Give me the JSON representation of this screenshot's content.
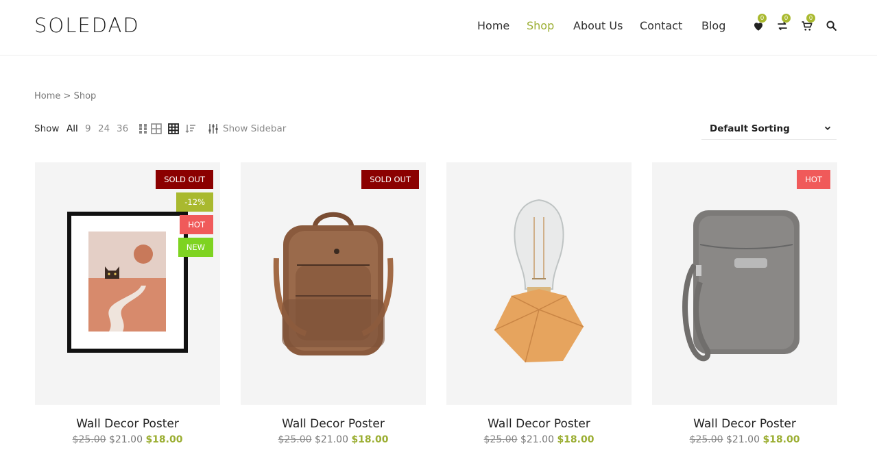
{
  "brand": {
    "logo": "SOLEDAD"
  },
  "nav": {
    "items": [
      {
        "label": "Home"
      },
      {
        "label": "Shop",
        "active": true
      },
      {
        "label": "About Us"
      },
      {
        "label": "Contact"
      },
      {
        "label": "Blog"
      }
    ]
  },
  "header_icons": {
    "wishlist_count": "0",
    "compare_count": "0",
    "cart_count": "0"
  },
  "breadcrumb": {
    "home": "Home",
    "separator": ">",
    "current": "Shop"
  },
  "toolbar": {
    "show_label": "Show",
    "per_page": [
      "All",
      "9",
      "24",
      "36"
    ],
    "sidebar_label": "Show Sidebar",
    "sort_selected": "Default Sorting"
  },
  "colors": {
    "accent": "#9bae32",
    "sold_out": "#8b0000",
    "hot": "#f05a5a",
    "new": "#7ed321",
    "sale": "#a9b92f"
  },
  "products": [
    {
      "title": "Wall Decor Poster",
      "price_old": "$25.00",
      "price_reg": "$21.00",
      "price_now": "$18.00",
      "tags": [
        "SOLD OUT",
        "-12%",
        "HOT",
        "NEW"
      ],
      "image": "framed-cat-poster"
    },
    {
      "title": "Wall Decor Poster",
      "price_old": "$25.00",
      "price_reg": "$21.00",
      "price_now": "$18.00",
      "tags": [
        "SOLD OUT"
      ],
      "image": "brown-leather-backpack"
    },
    {
      "title": "Wall Decor Poster",
      "price_old": "$25.00",
      "price_reg": "$21.00",
      "price_now": "$18.00",
      "tags": [],
      "image": "wooden-bulb-lamp"
    },
    {
      "title": "Wall Decor Poster",
      "price_old": "$25.00",
      "price_reg": "$21.00",
      "price_now": "$18.00",
      "tags": [
        "HOT"
      ],
      "image": "grey-crossbody-bag"
    }
  ]
}
